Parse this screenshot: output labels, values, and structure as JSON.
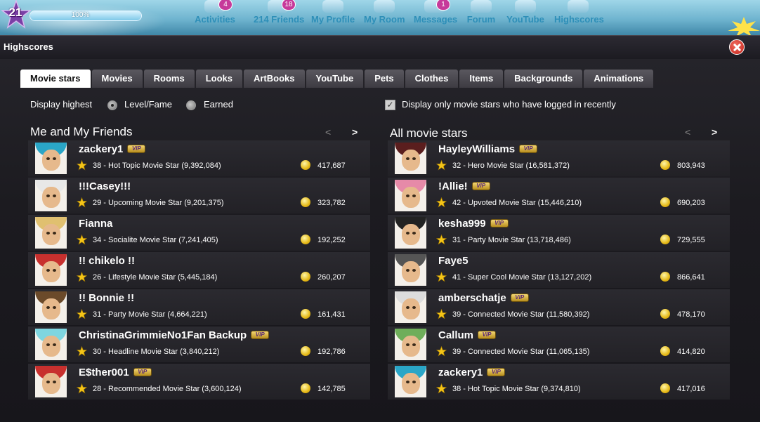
{
  "topbar": {
    "level": "21",
    "xp_percent": "100%",
    "xp_fraction": 1.0,
    "nav": [
      {
        "label": "Activities",
        "badge": "4",
        "icon": "activities-icon"
      },
      {
        "label": "214 Friends",
        "badge": "18",
        "icon": "friends-icon"
      },
      {
        "label": "My Profile",
        "badge": "",
        "icon": "profile-icon"
      },
      {
        "label": "My Room",
        "badge": "",
        "icon": "room-icon"
      },
      {
        "label": "Messages",
        "badge": "1",
        "icon": "messages-icon"
      },
      {
        "label": "Forum",
        "badge": "",
        "icon": "forum-icon"
      },
      {
        "label": "YouTube",
        "badge": "",
        "icon": "youtube-icon"
      },
      {
        "label": "Highscores",
        "badge": "",
        "icon": "trophy-icon"
      }
    ]
  },
  "window": {
    "title": "Highscores",
    "tabs": [
      "Movie stars",
      "Movies",
      "Rooms",
      "Looks",
      "ArtBooks",
      "YouTube",
      "Pets",
      "Clothes",
      "Items",
      "Backgrounds",
      "Animations"
    ],
    "active_tab": "Movie stars",
    "filter": {
      "label": "Display highest",
      "option_level": "Level/Fame",
      "option_earned": "Earned",
      "selected": "Level/Fame",
      "recent_checkbox_label": "Display only movie stars who have logged in recently",
      "recent_checked": true
    }
  },
  "colors": {
    "tab_active_bg": "#ffffff",
    "row_bg": "#2b2a30",
    "vip_gold": "#f4d774",
    "star_gold": "#f5c518",
    "close_red": "#d8352a"
  },
  "friends": {
    "title": "Me and My Friends",
    "prev": "<",
    "next": ">",
    "rows": [
      {
        "name": "zackery1",
        "vip": true,
        "level": "38 - Hot Topic Movie Star (9,392,084)",
        "coins": "417,687",
        "hair": "#2aa6c7"
      },
      {
        "name": "!!!Casey!!!",
        "vip": false,
        "level": "29 - Upcoming Movie Star (9,201,375)",
        "coins": "323,782",
        "hair": "#e8e8e8"
      },
      {
        "name": "Fianna",
        "vip": false,
        "level": "34 - Socialite Movie Star (7,241,405)",
        "coins": "192,252",
        "hair": "#e0c070"
      },
      {
        "name": "!! chikelo !!",
        "vip": false,
        "level": "26 - Lifestyle Movie Star (5,445,184)",
        "coins": "260,207",
        "hair": "#c8302e"
      },
      {
        "name": "!! Bonnie !!",
        "vip": false,
        "level": "31 - Party Movie Star (4,664,221)",
        "coins": "161,431",
        "hair": "#6b4a2a"
      },
      {
        "name": "ChristinaGrimmieNo1Fan Backup",
        "vip": true,
        "level": "30 - Headline Movie Star (3,840,212)",
        "coins": "192,786",
        "hair": "#7fd6e0"
      },
      {
        "name": "E$ther001",
        "vip": true,
        "level": "28 - Recommended Movie Star (3,600,124)",
        "coins": "142,785",
        "hair": "#c8302e"
      }
    ]
  },
  "all": {
    "title": "All movie stars",
    "prev": "<",
    "next": ">",
    "rows": [
      {
        "name": "HayleyWilliams",
        "vip": true,
        "level": "32 - Hero Movie Star (16,581,372)",
        "coins": "803,943",
        "hair": "#5a1e1e"
      },
      {
        "name": "!Allie!",
        "vip": true,
        "level": "42 - Upvoted Movie Star (15,446,210)",
        "coins": "690,203",
        "hair": "#e68aa8"
      },
      {
        "name": "kesha999",
        "vip": true,
        "level": "31 - Party Movie Star (13,718,486)",
        "coins": "729,555",
        "hair": "#222222"
      },
      {
        "name": "Faye5",
        "vip": false,
        "level": "41 - Super Cool Movie Star (13,127,202)",
        "coins": "866,641",
        "hair": "#555555"
      },
      {
        "name": "amberschatje",
        "vip": true,
        "level": "39 - Connected Movie Star (11,580,392)",
        "coins": "478,170",
        "hair": "#dddddd"
      },
      {
        "name": "Callum",
        "vip": true,
        "level": "39 - Connected Movie Star (11,065,135)",
        "coins": "414,820",
        "hair": "#6fae5a"
      },
      {
        "name": "zackery1",
        "vip": true,
        "level": "38 - Hot Topic Movie Star (9,374,810)",
        "coins": "417,016",
        "hair": "#2aa6c7"
      }
    ]
  },
  "vip_label": "VIP"
}
